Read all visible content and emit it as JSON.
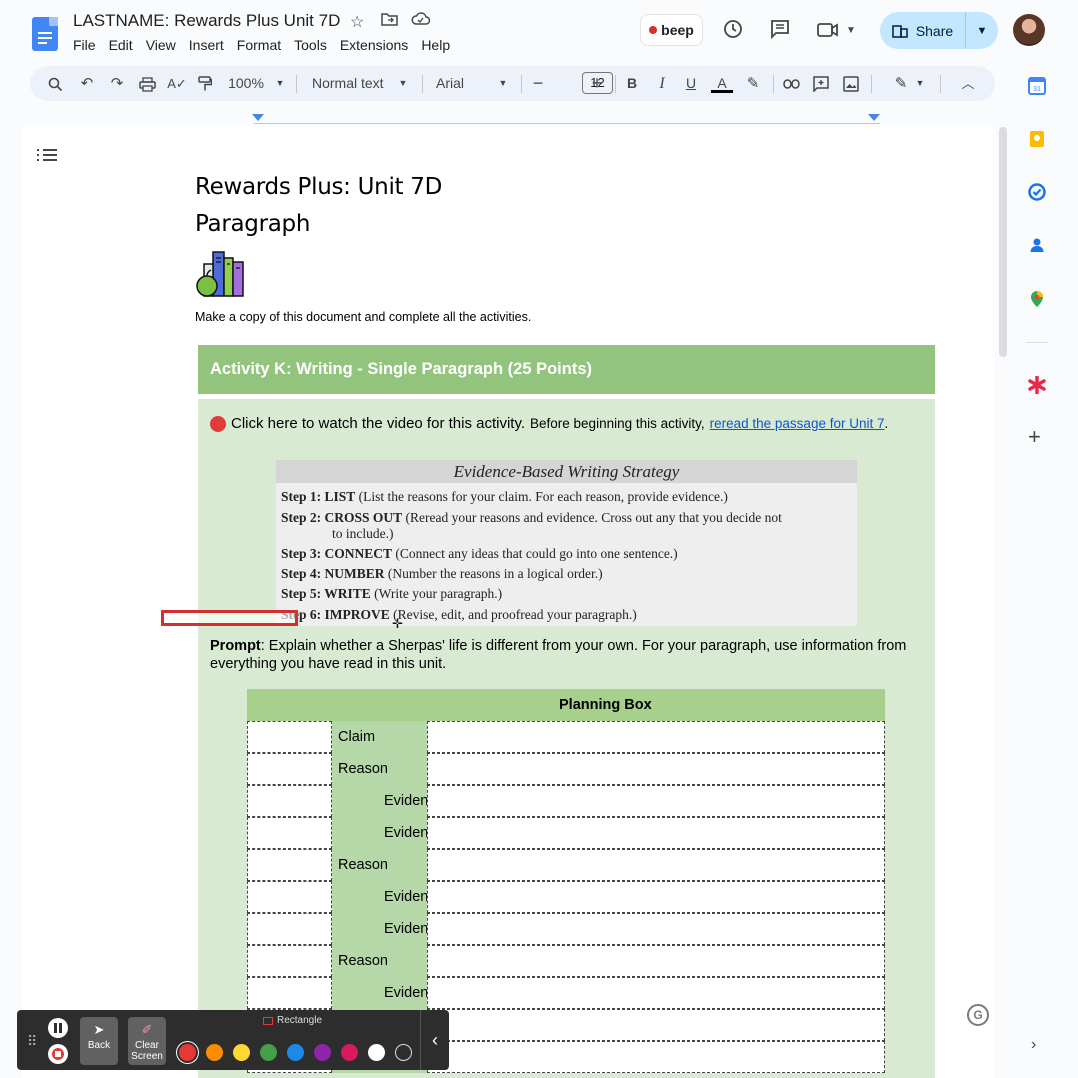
{
  "header": {
    "doc_title": "LASTNAME: Rewards Plus Unit 7D",
    "menu": [
      "File",
      "Edit",
      "View",
      "Insert",
      "Format",
      "Tools",
      "Extensions",
      "Help"
    ],
    "beep_label": "beep",
    "share_label": "Share"
  },
  "toolbar": {
    "zoom": "100%",
    "style": "Normal text",
    "font": "Arial",
    "font_size": "12"
  },
  "document": {
    "title_line1": "Rewards Plus: Unit 7D",
    "title_line2": "Paragraph",
    "instruction": "Make a copy of this document and complete all the activities.",
    "activity_title": "Activity K: Writing - Single Paragraph (25 Points)",
    "video_text": "Click here to watch the video for this activity.",
    "video_before": "Before beginning this activity,",
    "video_link": "reread the passage for Unit 7",
    "video_end": ".",
    "strategy_title": "Evidence-Based Writing Strategy",
    "steps": [
      {
        "label": "Step 1: LIST",
        "text": " (List the reasons for your claim. For each reason, provide evidence.)"
      },
      {
        "label": "Step 2: CROSS OUT",
        "text": " (Reread your reasons and evidence. Cross out any that you decide not"
      },
      {
        "label": "",
        "text": "to include.)"
      },
      {
        "label": "Step 3: CONNECT",
        "text": " (Connect any ideas that could go into one sentence.)"
      },
      {
        "label": "Step 4: NUMBER",
        "text": " (Number the reasons in a logical order.)"
      },
      {
        "label": "Step 5: WRITE",
        "text": " (Write your paragraph.)"
      },
      {
        "label": "Step 6: IMPROVE",
        "text": " (Revise, edit, and proofread your paragraph.)"
      }
    ],
    "prompt_label": "Prompt",
    "prompt_text": ": Explain whether a Sherpas' life is different from your own. For your paragraph, use information from everything you have read in this unit.",
    "planning_title": "Planning Box",
    "planning_rows": [
      "Claim",
      "Reason",
      "Evidence",
      "Evidence",
      "Reason",
      "Evidence",
      "Evidence",
      "Reason",
      "Evidence",
      "",
      ""
    ]
  },
  "palette": {
    "back_label": "Back",
    "clear_label": "Clear Screen",
    "tool_label": "Rectangle",
    "colors": [
      "#e53935",
      "#fb8c00",
      "#fdd835",
      "#43a047",
      "#1e88e5",
      "#8e24aa",
      "#d81b60",
      "#ffffff",
      "#2d2d2d"
    ],
    "selected_color": "#e53935"
  },
  "grammarly_label": "G",
  "icons": {
    "search": "search-icon",
    "undo": "undo-icon",
    "redo": "redo-icon",
    "print": "print-icon",
    "spellcheck": "spellcheck-icon",
    "paint_format": "paint-format-icon"
  }
}
